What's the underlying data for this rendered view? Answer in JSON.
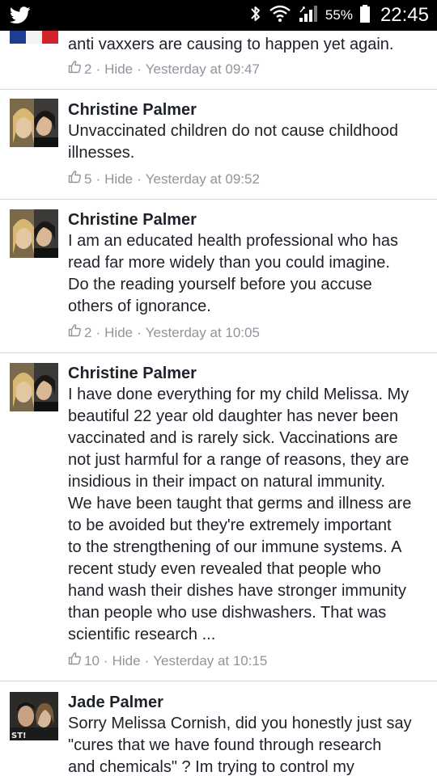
{
  "status_bar": {
    "battery_percent": "55%",
    "time": "22:45"
  },
  "comments": [
    {
      "name": "",
      "text": "anti vaxxers are causing to happen yet again.",
      "likes": "2",
      "hide": "Hide",
      "time": "Yesterday at 09:47"
    },
    {
      "name": "Christine Palmer",
      "text": "Unvaccinated children do not cause childhood\nillnesses.",
      "likes": "5",
      "hide": "Hide",
      "time": "Yesterday at 09:52"
    },
    {
      "name": "Christine Palmer",
      "text": "I am an educated health professional who has\nread far more widely than you could imagine.\nDo the reading yourself before you accuse\nothers of ignorance.",
      "likes": "2",
      "hide": "Hide",
      "time": "Yesterday at 10:05"
    },
    {
      "name": "Christine Palmer",
      "text": "I have done everything for my child Melissa. My\nbeautiful 22 year old daughter has never been\nvaccinated and is rarely sick. Vaccinations are\nnot just harmful for a range of reasons, they are\ninsidious in their impact on natural immunity.\nWe have been taught that germs and illness are\nto be avoided but they're extremely important\nto the strengthening of our immune systems. A\nrecent study even revealed that people who\nhand wash their dishes have stronger immunity\nthan people who use dishwashers. That was\nscientific research ...",
      "likes": "10",
      "hide": "Hide",
      "time": "Yesterday at 10:15"
    },
    {
      "name": "Jade Palmer",
      "text": "Sorry Melissa Cornish, did you honestly just say\n\"cures that we have found through research\nand chemicals\" ? Im trying to control my",
      "likes": "",
      "hide": "",
      "time": ""
    }
  ],
  "colors": {
    "background": "#e9ebee",
    "card": "#ffffff",
    "meta_text": "#90949c",
    "primary_text": "#1d2129"
  },
  "icons": [
    "twitter-icon",
    "bluetooth-icon",
    "wifi-icon",
    "signal-icon",
    "battery-icon",
    "like-thumb-icon",
    "flag-avatar"
  ]
}
